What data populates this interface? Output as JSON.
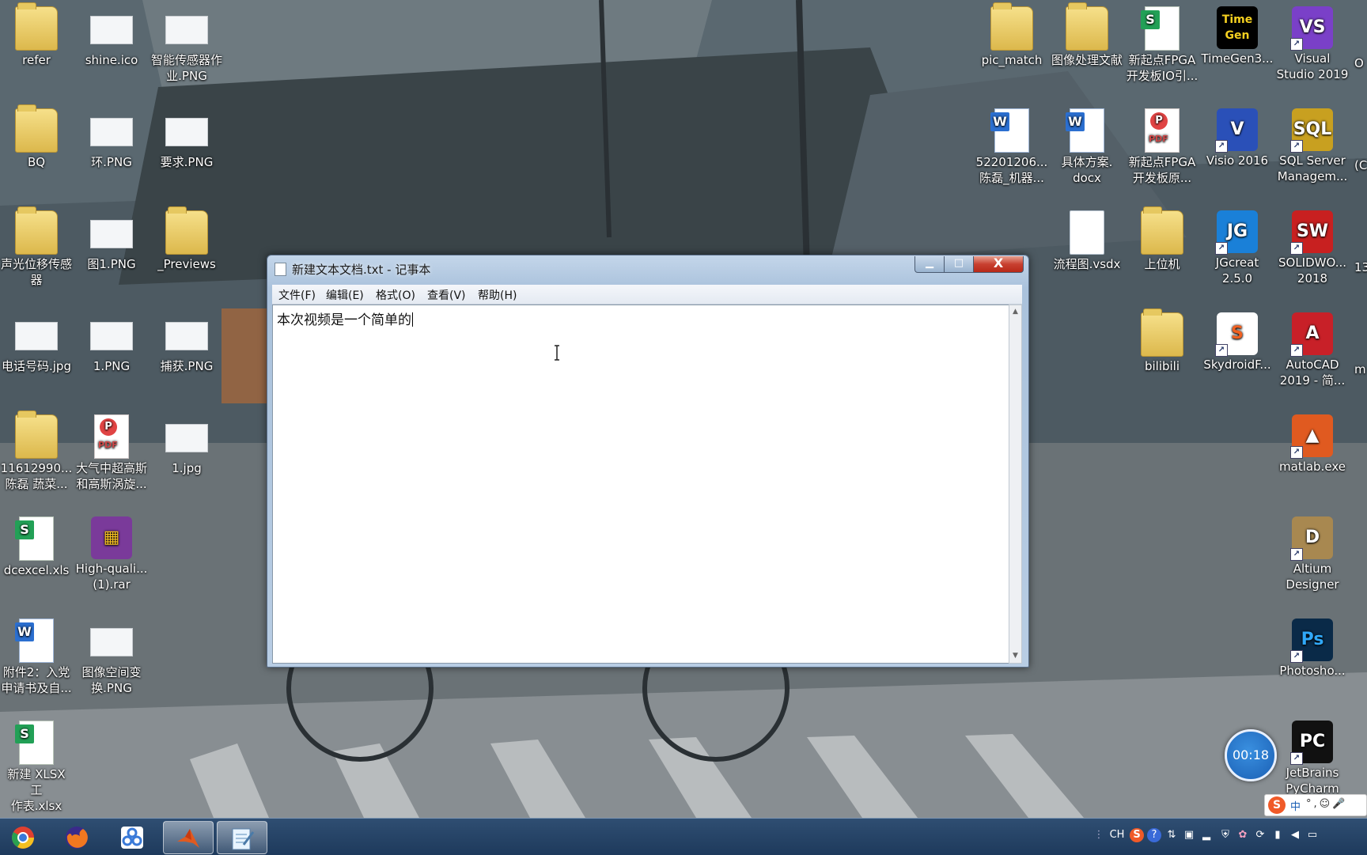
{
  "desktop_icons_left": [
    {
      "label": "refer",
      "type": "folder",
      "col": 0,
      "row": 0
    },
    {
      "label": "shine.ico",
      "type": "image",
      "col": 1,
      "row": 0
    },
    {
      "label": "智能传感器作\n业.PNG",
      "type": "image",
      "col": 2,
      "row": 0
    },
    {
      "label": "BQ",
      "type": "folder",
      "col": 0,
      "row": 1
    },
    {
      "label": "环.PNG",
      "type": "image",
      "col": 1,
      "row": 1
    },
    {
      "label": "要求.PNG",
      "type": "image",
      "col": 2,
      "row": 1
    },
    {
      "label": "声光位移传感\n器",
      "type": "folder",
      "col": 0,
      "row": 2
    },
    {
      "label": "图1.PNG",
      "type": "image",
      "col": 1,
      "row": 2
    },
    {
      "label": "_Previews",
      "type": "folder",
      "col": 2,
      "row": 2
    },
    {
      "label": "电话号码.jpg",
      "type": "image",
      "col": 0,
      "row": 3
    },
    {
      "label": "1.PNG",
      "type": "image",
      "col": 1,
      "row": 3
    },
    {
      "label": "捕获.PNG",
      "type": "image",
      "col": 2,
      "row": 3
    },
    {
      "label": "11612990...\n陈磊 蔬菜...",
      "type": "folder",
      "col": 0,
      "row": 4
    },
    {
      "label": "大气中超高斯\n和高斯涡旋...",
      "type": "pdf",
      "col": 1,
      "row": 4
    },
    {
      "label": "1.jpg",
      "type": "image",
      "col": 2,
      "row": 4
    },
    {
      "label": "dcexcel.xls",
      "type": "sheet",
      "col": 0,
      "row": 5
    },
    {
      "label": "High-quali...\n(1).rar",
      "type": "rar",
      "col": 1,
      "row": 5
    },
    {
      "label": "附件2：入党\n申请书及自...",
      "type": "word",
      "col": 0,
      "row": 6
    },
    {
      "label": "图像空间变\n换.PNG",
      "type": "image",
      "col": 1,
      "row": 6
    },
    {
      "label": "新建 XLSX 工\n作表.xlsx",
      "type": "sheet",
      "col": 0,
      "row": 7
    }
  ],
  "desktop_icons_right": [
    {
      "label": "pic_match",
      "type": "folder",
      "col": 0,
      "row": 0
    },
    {
      "label": "图像处理文献",
      "type": "folder",
      "col": 1,
      "row": 0
    },
    {
      "label": "新起点FPGA\n开发板IO引...",
      "type": "sheet",
      "col": 2,
      "row": 0
    },
    {
      "label": "TimeGen3...",
      "type": "timegen",
      "col": 3,
      "row": 0
    },
    {
      "label": "Visual\nStudio 2019",
      "type": "vs",
      "col": 4,
      "row": 0
    },
    {
      "label": "52201206...\n陈磊_机器...",
      "type": "word",
      "col": 0,
      "row": 1
    },
    {
      "label": "具体方案.\ndocx",
      "type": "word",
      "col": 1,
      "row": 1
    },
    {
      "label": "新起点FPGA\n开发板原...",
      "type": "pdf",
      "col": 2,
      "row": 1
    },
    {
      "label": "Visio 2016",
      "type": "visio",
      "col": 3,
      "row": 1
    },
    {
      "label": "SQL Server\nManagem...",
      "type": "sql",
      "col": 4,
      "row": 1
    },
    {
      "label": "流程图.vsdx",
      "type": "doc",
      "col": 1,
      "row": 2
    },
    {
      "label": "上位机",
      "type": "folder",
      "col": 2,
      "row": 2
    },
    {
      "label": "JGcreat\n2.5.0",
      "type": "jg",
      "col": 3,
      "row": 2
    },
    {
      "label": "SOLIDWO...\n2018",
      "type": "sw",
      "col": 4,
      "row": 2
    },
    {
      "label": "bilibili",
      "type": "folder",
      "col": 2,
      "row": 3
    },
    {
      "label": "SkydroidF...",
      "type": "sky",
      "col": 3,
      "row": 3
    },
    {
      "label": "AutoCAD\n2019 - 简...",
      "type": "acad",
      "col": 4,
      "row": 3
    },
    {
      "label": "matlab.exe",
      "type": "matlab",
      "col": 4,
      "row": 4
    },
    {
      "label": "Altium\nDesigner",
      "type": "altium",
      "col": 4,
      "row": 5
    },
    {
      "label": "Photosho...",
      "type": "ps",
      "col": 4,
      "row": 6
    },
    {
      "label": "JetBrains\nPyCharm",
      "type": "pc",
      "col": 4,
      "row": 7
    }
  ],
  "edge_labels": [
    {
      "text": "O",
      "row": 0
    },
    {
      "text": "(C",
      "row": 1
    },
    {
      "text": "13",
      "row": 2
    },
    {
      "text": "m",
      "row": 3
    }
  ],
  "notepad": {
    "title": "新建文本文档.txt - 记事本",
    "minimize_label": "▁",
    "maximize_label": "□",
    "close_label": "X",
    "menu": [
      "文件(F)",
      "编辑(E)",
      "格式(O)",
      "查看(V)",
      "帮助(H)"
    ],
    "content": "本次视频是一个简单的",
    "scroll_up": "▲",
    "scroll_down": "▼"
  },
  "timer": {
    "value": "00:18"
  },
  "ime": {
    "logo": "S",
    "mode": "中",
    "extras": "°,☺🎤"
  },
  "taskbar": {
    "apps": [
      {
        "name": "chrome",
        "color": "#e04030"
      },
      {
        "name": "firefox",
        "color": "#f07820"
      },
      {
        "name": "photo-viewer",
        "color": "#3a7ad8"
      },
      {
        "name": "matlab",
        "color": "#e05a20"
      },
      {
        "name": "notepad",
        "color": "#8ab8e0"
      }
    ],
    "tray_lang": "CH",
    "tray_help": "?",
    "tray_signal": "📶"
  },
  "colors": {
    "accent": "#1a5fb4",
    "close": "#c84030"
  }
}
